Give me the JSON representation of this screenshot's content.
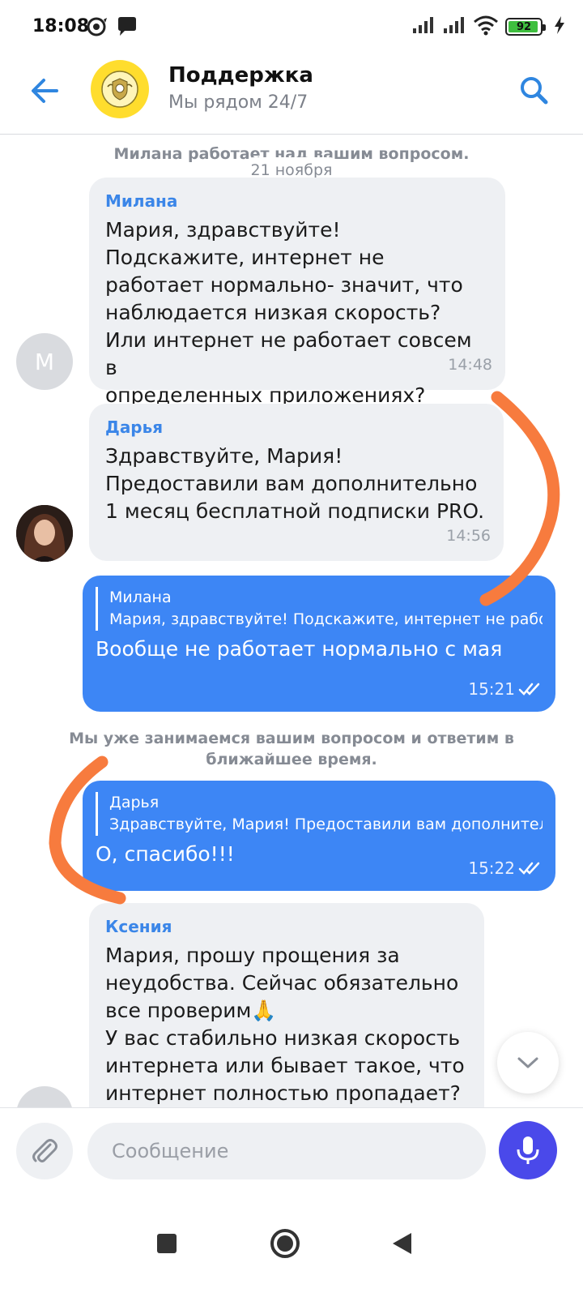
{
  "status_bar": {
    "time": "18:08",
    "battery": "92"
  },
  "header": {
    "title": "Поддержка",
    "subtitle": "Мы рядом 24/7"
  },
  "chat": {
    "top_system": "Милана работает над вашим вопросом.",
    "date": "21 ноября",
    "messages": [
      {
        "sender": "Милана",
        "avatar": "М",
        "text": "Мария, здравствуйте!\nПодскажите, интернет не\nработает нормально- значит, что\nнаблюдается низкая скорость?\nИли интернет не работает совсем в\nопределенных приложениях?",
        "time": "14:48"
      },
      {
        "sender": "Дарья",
        "text": "Здравствуйте, Мария!\nПредоставили вам дополнительно\n1 месяц бесплатной подписки PRO.",
        "time": "14:56"
      },
      {
        "reply_name": "Милана",
        "reply_text": "Мария, здравствуйте! Подскажите, интернет не работает нормально",
        "text": "Вообще не работает нормально с мая",
        "time": "15:21"
      },
      {
        "reply_name": "Дарья",
        "reply_text": "Здравствуйте, Мария!  Предоставили вам дополнительно",
        "text": "О, спасибо!!!",
        "time": "15:22"
      },
      {
        "sender": "Ксения",
        "text": "Мария, прошу прощения за\nнеудобства. Сейчас обязательно\nвсе проверим🙏\nУ вас стабильно низкая скорость\nинтернета или бывает такое, что\nинтернет полностью пропадает?"
      }
    ],
    "system_mid": "Мы уже занимаемся вашим вопросом и ответим в ближайшее время."
  },
  "composer": {
    "placeholder": "Сообщение"
  },
  "colors": {
    "accent": "#3d86f5",
    "incoming_bubble": "#eef0f3",
    "annotation": "#f77b3e",
    "logo": "#ffdd2d",
    "mic": "#4a49ea"
  }
}
